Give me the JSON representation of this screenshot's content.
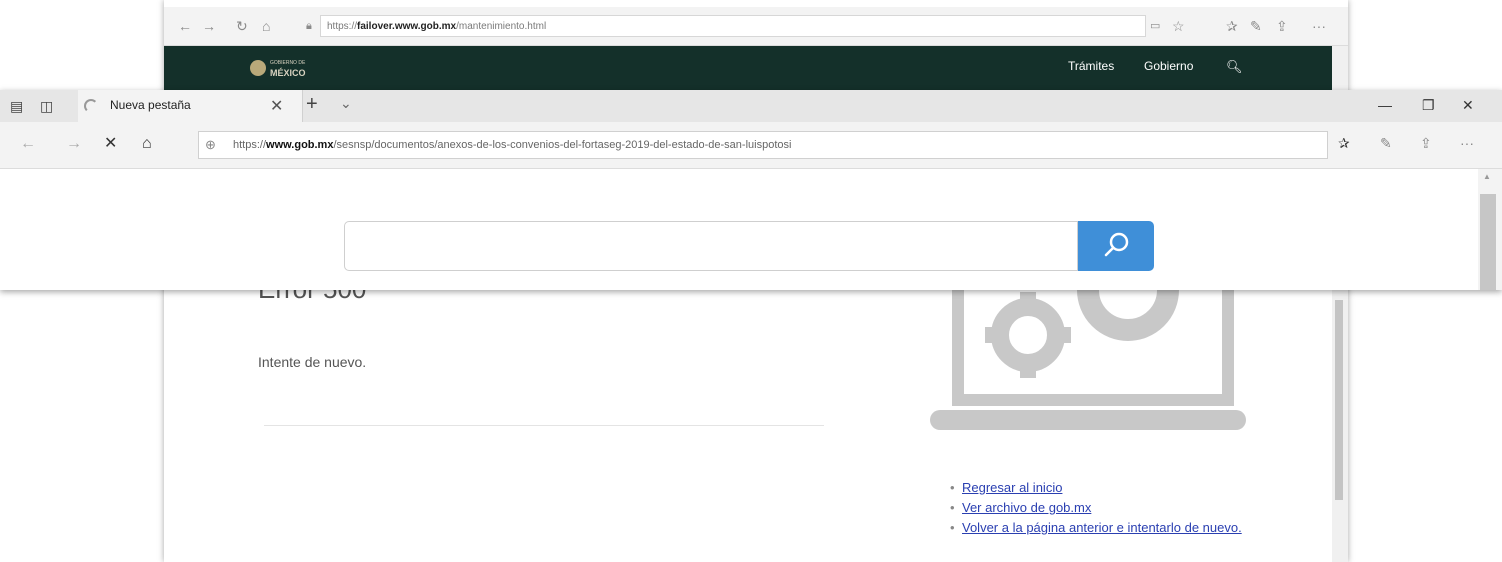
{
  "back_window": {
    "address": {
      "scheme": "https://",
      "host": "failover.www.gob.mx",
      "path": "/mantenimiento.html"
    },
    "navbar": {
      "logo_line1": "GOBIERNO DE",
      "logo_line2": "MÉXICO",
      "links": [
        "Trámites",
        "Gobierno"
      ]
    },
    "page": {
      "error_heading": "Error 500",
      "error_message": "Intente de nuevo.",
      "help_links": [
        "Regresar al inicio",
        "Ver archivo de gob.mx",
        "Volver a la página anterior e intentarlo de nuevo."
      ]
    }
  },
  "front_window": {
    "tab": {
      "title": "Nueva pestaña"
    },
    "address": {
      "scheme": "https://",
      "host": "www.gob.mx",
      "path": "/sesnsp/documentos/anexos-de-los-convenios-del-fortaseg-2019-del-estado-de-san-luispotosi"
    },
    "search": {
      "value": "",
      "placeholder": ""
    }
  },
  "colors": {
    "navbar_bg": "#14302a",
    "search_button": "#3f8fd8",
    "link": "#2a3fb1",
    "illustration": "#c8c8c8"
  }
}
